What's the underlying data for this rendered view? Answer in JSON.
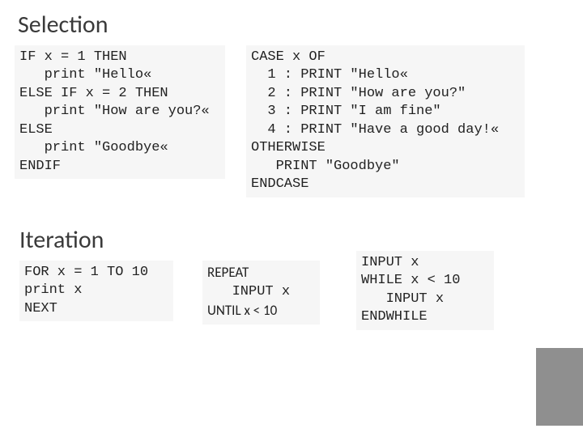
{
  "headings": {
    "selection": "Selection",
    "iteration": "Iteration"
  },
  "code": {
    "if_block": "IF x = 1 THEN\n   print \"Hello«\nELSE IF x = 2 THEN\n   print \"How are you?«\nELSE\n   print \"Goodbye«\nENDIF",
    "case_block": "CASE x OF\n  1 : PRINT \"Hello«\n  2 : PRINT \"How are you?\"\n  3 : PRINT \"I am fine\"\n  4 : PRINT \"Have a good day!«\nOTHERWISE\n   PRINT \"Goodbye\"\nENDCASE",
    "for_block": "FOR x = 1 TO 10\nprint x\nNEXT",
    "repeat_line1": "REPEAT",
    "repeat_line2": "   INPUT x",
    "repeat_line3": "UNTIL x < 10",
    "while_block": "INPUT x\nWHILE x < 10\n   INPUT x\nENDWHILE"
  }
}
